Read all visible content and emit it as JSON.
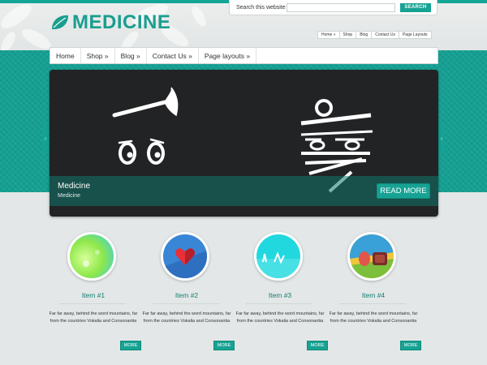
{
  "brand": {
    "name": "MEDICINE",
    "accent": "#17a393"
  },
  "search": {
    "label": "Search this website",
    "placeholder": "",
    "button": "SEARCH"
  },
  "secondary_nav": [
    "Home »",
    "Shop",
    "Blog",
    "Contact Us",
    "Page Layouts"
  ],
  "main_nav": [
    "Home",
    "Shop »",
    "Blog »",
    "Contact Us »",
    "Page layouts »"
  ],
  "slider": {
    "caption_title": "Medicine",
    "caption_subtitle": "Medicine",
    "read_more": "READ MORE",
    "prev_icon": "chevron-left-icon",
    "next_icon": "chevron-right-icon"
  },
  "items": [
    {
      "title": "Item #1",
      "description": "Far far away, behind the word mountains, far from the countries Vokalia and Consonantia",
      "more": "MORE"
    },
    {
      "title": "Item #2",
      "description": "Far far away, behind the word mountains, far from the countries Vokalia and Consonantia",
      "more": "MORE"
    },
    {
      "title": "Item #3",
      "description": "Far far away, behind the word mountains, far from the countries Vokalia and Consonantia",
      "more": "MORE"
    },
    {
      "title": "Item #4",
      "description": "Far far away, behind the word mountains, far from the countries Vokalia and Consonantia",
      "more": "MORE"
    }
  ]
}
